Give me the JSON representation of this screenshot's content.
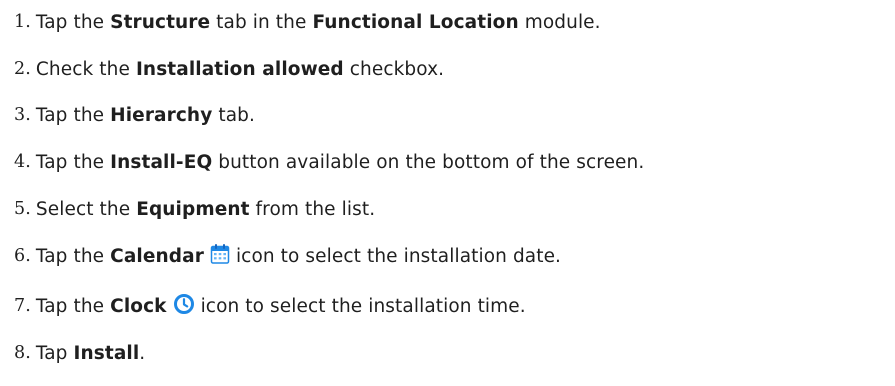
{
  "steps": [
    {
      "number": "1.",
      "t1": "Tap the ",
      "b1": "Structure",
      "t2": " tab in the ",
      "b2": "Functional Location",
      "t3": " module."
    },
    {
      "number": "2.",
      "t1": "Check the ",
      "b1": "Installation allowed",
      "t2": " checkbox."
    },
    {
      "number": "3.",
      "t1": "Tap the ",
      "b1": "Hierarchy",
      "t2": " tab."
    },
    {
      "number": "4.",
      "t1": "Tap the ",
      "b1": "Install-EQ",
      "t2": " button available on the bottom of the screen."
    },
    {
      "number": "5.",
      "t1": "Select the ",
      "b1": "Equipment",
      "t2": " from the list."
    },
    {
      "number": "6.",
      "t1": "Tap the ",
      "b1": "Calendar",
      "icon": "calendar-icon",
      "t2": " icon to select the installation date."
    },
    {
      "number": "7.",
      "t1": "Tap the ",
      "b1": "Clock",
      "icon": "clock-icon",
      "t2": " icon to select the installation time."
    },
    {
      "number": "8.",
      "t1": "Tap ",
      "b1": "Install",
      "t2": "."
    }
  ],
  "colors": {
    "text": "#1f1f1f",
    "icon_blue": "#1e88e5"
  }
}
